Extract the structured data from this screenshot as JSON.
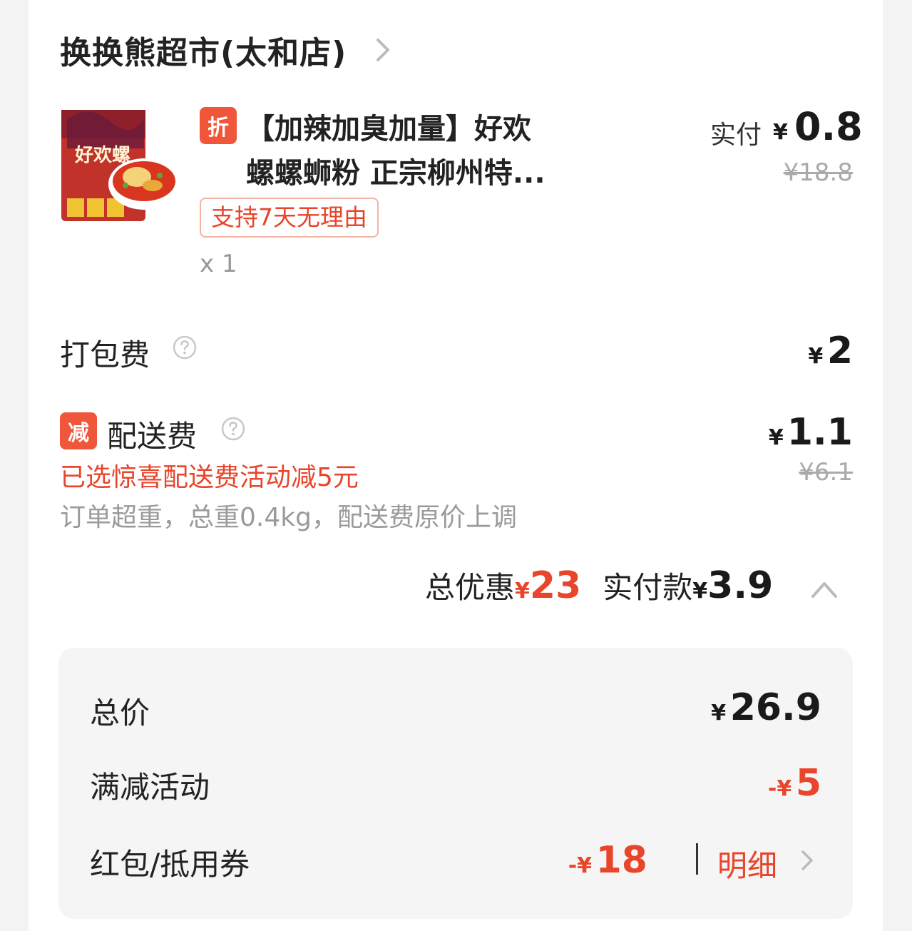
{
  "store": {
    "name": "换换熊超市(太和店)"
  },
  "product": {
    "discount_tag": "折",
    "title_line1": "【加辣加臭加量】好欢",
    "title_line2": "螺螺蛳粉 正宗柳州特...",
    "image_text": "好欢螺",
    "return_badge": "支持7天无理由",
    "quantity": "x 1",
    "paid_label": "实付",
    "currency": "¥",
    "paid_value": "0.8",
    "original_price": "¥18.8"
  },
  "packing": {
    "label": "打包费",
    "currency": "¥",
    "value": "2"
  },
  "delivery": {
    "tag": "减",
    "label": "配送费",
    "currency": "¥",
    "value": "1.1",
    "original": "¥6.1",
    "promo_note": "已选惊喜配送费活动减5元",
    "weight_note": "订单超重，总重0.4kg，配送费原价上调"
  },
  "summary": {
    "discount_label": "总优惠",
    "currency": "¥",
    "discount_value": "23",
    "paid_label": "实付款",
    "paid_value": "3.9"
  },
  "details": {
    "total_label": "总价",
    "total_currency": "¥",
    "total_value": "26.9",
    "fullcut_label": "满减活动",
    "fullcut_prefix": "-¥",
    "fullcut_value": "5",
    "coupon_label": "红包/抵用券",
    "coupon_prefix": "-¥",
    "coupon_value": "18",
    "detail_link": "明细"
  },
  "colors": {
    "accent": "#e8452b",
    "tag_bg": "#f0573a",
    "muted": "#9a9a9a"
  }
}
